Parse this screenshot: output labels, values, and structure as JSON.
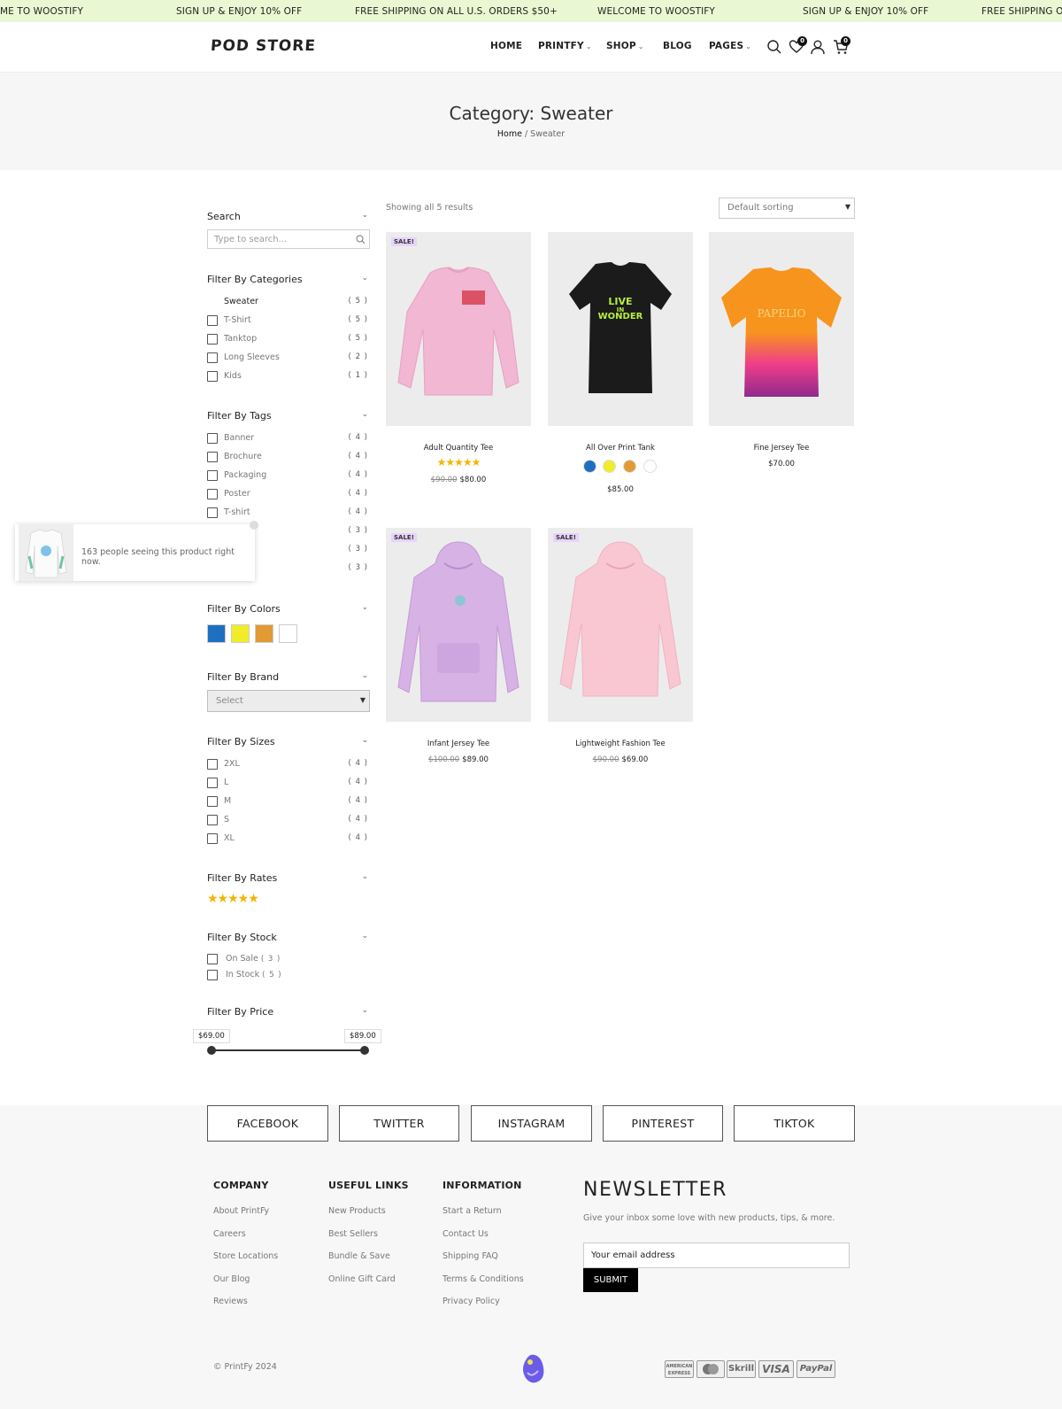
{
  "marquee": [
    "ME TO WOOSTIFY",
    "SIGN UP & ENJOY 10% OFF",
    "FREE SHIPPING ON ALL U.S. ORDERS $50+",
    "WELCOME TO WOOSTIFY",
    "SIGN UP & ENJOY 10% OFF",
    "FREE SHIPPING ON A"
  ],
  "header": {
    "logo": "POD STORE",
    "nav": [
      "HOME",
      "PRINTFY",
      "SHOP",
      "BLOG",
      "PAGES"
    ],
    "wishlist_count": "0",
    "cart_count": "0",
    "icons": [
      "search-icon",
      "heart-icon",
      "user-icon",
      "cart-icon"
    ]
  },
  "banner": {
    "title": "Category: Sweater",
    "crumb_home": "Home",
    "crumb_sep": " / ",
    "crumb_current": "Sweater"
  },
  "sidebar": {
    "search_title": "Search",
    "search_placeholder": "Type to search...",
    "categories_title": "Filter By Categories",
    "categories": [
      {
        "label": "Sweater",
        "count": "( 5 )"
      },
      {
        "label": "T-Shirt",
        "count": "( 5 )"
      },
      {
        "label": "Tanktop",
        "count": "( 5 )"
      },
      {
        "label": "Long Sleeves",
        "count": "( 2 )"
      },
      {
        "label": "Kids",
        "count": "( 1 )"
      }
    ],
    "tags_title": "Filter By Tags",
    "tags": [
      {
        "label": "Banner",
        "count": "( 4 )"
      },
      {
        "label": "Brochure",
        "count": "( 4 )"
      },
      {
        "label": "Packaging",
        "count": "( 4 )"
      },
      {
        "label": "Poster",
        "count": "( 4 )"
      },
      {
        "label": "T-shirt",
        "count": "( 4 )"
      }
    ],
    "tag_hidden_counts": [
      "( 3 )",
      "( 3 )",
      "( 3 )"
    ],
    "colors_title": "Filter By Colors",
    "colors": [
      "#1f6fc1",
      "#f0ec2a",
      "#e19a34",
      "#ffffff"
    ],
    "brand_title": "Filter By Brand",
    "brand_select": "Select",
    "sizes_title": "Filter By Sizes",
    "sizes": [
      {
        "label": "2XL",
        "count": "( 4 )"
      },
      {
        "label": "L",
        "count": "( 4 )"
      },
      {
        "label": "M",
        "count": "( 4 )"
      },
      {
        "label": "S",
        "count": "( 4 )"
      },
      {
        "label": "XL",
        "count": "( 4 )"
      }
    ],
    "rates_title": "Filter By Rates",
    "rates_stars": 5,
    "stock_title": "Filter By Stock",
    "stock": [
      {
        "label": "On Sale",
        "count": "( 3 )"
      },
      {
        "label": "In Stock",
        "count": "( 5 )"
      }
    ],
    "price_title": "Filter By Price",
    "price_min": "$69.00",
    "price_max": "$89.00"
  },
  "shop": {
    "results": "Showing all 5 results",
    "sort": "Default sorting",
    "sale_label": "SALE!",
    "products": [
      {
        "name": "Adult Quantity Tee",
        "old": "$90.00",
        "price": "$80.00",
        "sale": true,
        "rating": 5
      },
      {
        "name": "All Over Print Tank",
        "price": "$85.00",
        "sale": false,
        "swatches": [
          "#1f6fc1",
          "#f0ec2a",
          "#e19a34",
          "#ffffff"
        ]
      },
      {
        "name": "Fine Jersey Tee",
        "price": "$70.00",
        "sale": false
      },
      {
        "name": "Infant Jersey Tee",
        "old": "$100.00",
        "price": "$89.00",
        "sale": true
      },
      {
        "name": "Lightweight Fashion Tee",
        "old": "$90.00",
        "price": "$69.00",
        "sale": true
      }
    ],
    "print_text": [
      "LIVE",
      "IN",
      "WONDER",
      "PAPELIO"
    ]
  },
  "popup": {
    "text": "163 people seeing this product right now."
  },
  "social": [
    "FACEBOOK",
    "TWITTER",
    "INSTAGRAM",
    "PINTEREST",
    "TIKTOK"
  ],
  "footer": {
    "company_title": "COMPANY",
    "company": [
      "About PrintFy",
      "Careers",
      "Store Locations",
      "Our Blog",
      "Reviews"
    ],
    "links_title": "USEFUL LINKS",
    "links": [
      "New Products",
      "Best Sellers",
      "Bundle & Save",
      "Online Gift Card"
    ],
    "info_title": "INFORMATION",
    "info": [
      "Start a Return",
      "Contact Us",
      "Shipping FAQ",
      "Terms & Conditions",
      "Privacy Policy"
    ],
    "newsletter_title": "NEWSLETTER",
    "newsletter_desc": "Give your inbox some love with new products, tips, & more.",
    "email_placeholder": "Your email address",
    "submit": "SUBMIT",
    "copyright": "© PrintFy 2024",
    "payments": [
      "AMERICAN EXPRESS",
      "mastercard",
      "Skrill",
      "VISA",
      "PayPal"
    ]
  }
}
